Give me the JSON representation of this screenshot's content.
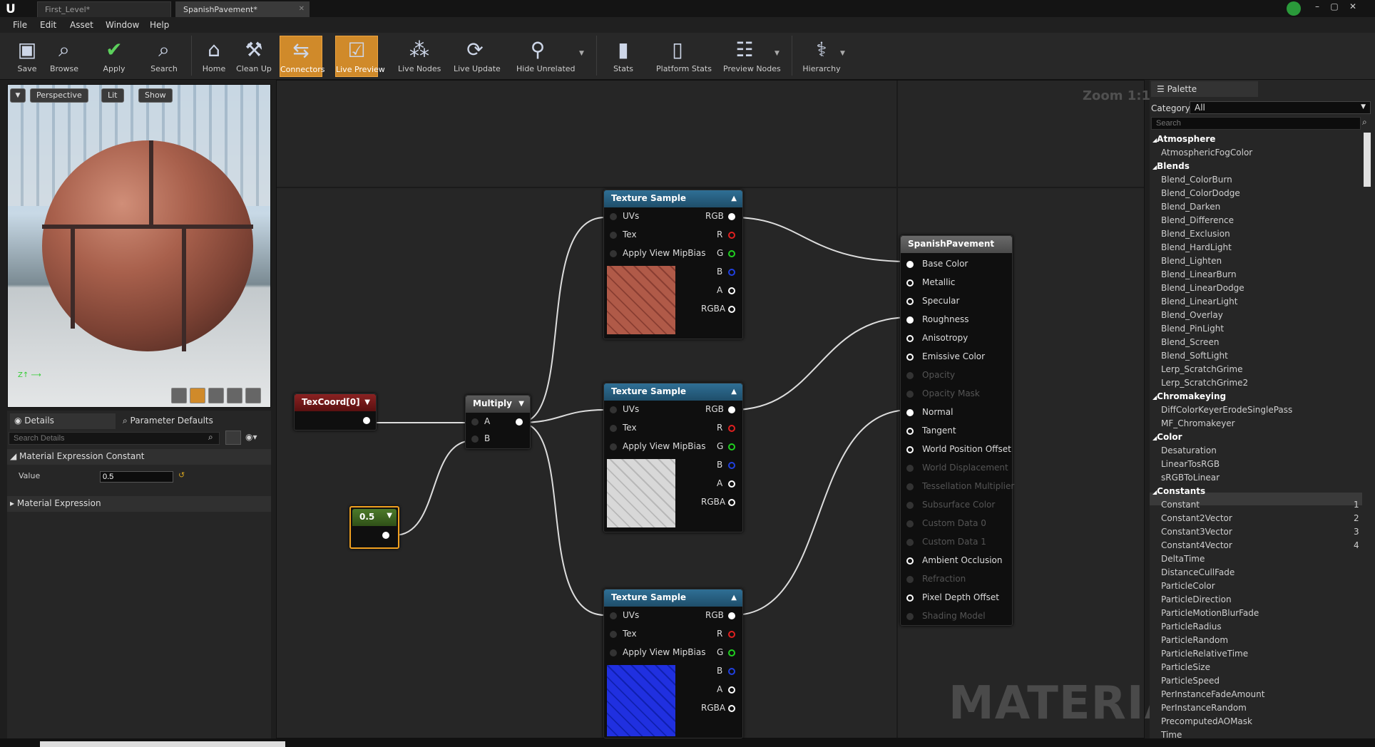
{
  "titlebar": {
    "tabs": [
      "First_Level*",
      "SpanishPavement*"
    ]
  },
  "menu": [
    "File",
    "Edit",
    "Asset",
    "Window",
    "Help"
  ],
  "toolbar": {
    "buttons": [
      "Save",
      "Browse",
      "Apply",
      "Search",
      "Home",
      "Clean Up",
      "Connectors",
      "Live Preview",
      "Live Nodes",
      "Live Update",
      "Hide Unrelated",
      "Stats",
      "Platform Stats",
      "Preview Nodes",
      "Hierarchy"
    ]
  },
  "viewport": {
    "perspective": "Perspective",
    "lit": "Lit",
    "show": "Show"
  },
  "details": {
    "tab1": "Details",
    "tab2": "Parameter Defaults",
    "search_placeholder": "Search Details",
    "section1": "Material Expression Constant",
    "value_label": "Value",
    "value": "0.5",
    "section2": "Material Expression"
  },
  "graph": {
    "zoom": "Zoom 1:1",
    "watermark": "MATERIAL",
    "texcoord": "TexCoord[0]",
    "multiply": "Multiply",
    "mul_a": "A",
    "mul_b": "B",
    "constant": "0.5",
    "tex_title": "Texture Sample",
    "tex_in": [
      "UVs",
      "Tex",
      "Apply View MipBias"
    ],
    "tex_out": [
      "RGB",
      "R",
      "G",
      "B",
      "A",
      "RGBA"
    ],
    "result_title": "SpanishPavement",
    "result_pins": [
      "Base Color",
      "Metallic",
      "Specular",
      "Roughness",
      "Anisotropy",
      "Emissive Color",
      "Opacity",
      "Opacity Mask",
      "Normal",
      "Tangent",
      "World Position Offset",
      "World Displacement",
      "Tessellation Multiplier",
      "Subsurface Color",
      "Custom Data 0",
      "Custom Data 1",
      "Ambient Occlusion",
      "Refraction",
      "Pixel Depth Offset",
      "Shading Model"
    ],
    "result_enabled": [
      true,
      true,
      true,
      true,
      true,
      true,
      false,
      false,
      true,
      true,
      true,
      false,
      false,
      false,
      false,
      false,
      true,
      false,
      true,
      false
    ]
  },
  "palette": {
    "title": "Palette",
    "category_label": "Category:",
    "category_value": "All",
    "search_placeholder": "Search",
    "groups": [
      {
        "name": "Atmosphere",
        "items": [
          "AtmosphericFogColor"
        ]
      },
      {
        "name": "Blends",
        "items": [
          "Blend_ColorBurn",
          "Blend_ColorDodge",
          "Blend_Darken",
          "Blend_Difference",
          "Blend_Exclusion",
          "Blend_HardLight",
          "Blend_Lighten",
          "Blend_LinearBurn",
          "Blend_LinearDodge",
          "Blend_LinearLight",
          "Blend_Overlay",
          "Blend_PinLight",
          "Blend_Screen",
          "Blend_SoftLight",
          "Lerp_ScratchGrime",
          "Lerp_ScratchGrime2"
        ]
      },
      {
        "name": "Chromakeying",
        "items": [
          "DiffColorKeyerErodeSinglePass",
          "MF_Chromakeyer"
        ]
      },
      {
        "name": "Color",
        "items": [
          "Desaturation",
          "LinearTosRGB",
          "sRGBToLinear"
        ]
      },
      {
        "name": "Constants",
        "items": [
          "Constant",
          "Constant2Vector",
          "Constant3Vector",
          "Constant4Vector",
          "DeltaTime",
          "DistanceCullFade",
          "ParticleColor",
          "ParticleDirection",
          "ParticleMotionBlurFade",
          "ParticleRadius",
          "ParticleRandom",
          "ParticleRelativeTime",
          "ParticleSize",
          "ParticleSpeed",
          "PerInstanceFadeAmount",
          "PerInstanceRandom",
          "PrecomputedAOMask",
          "Time"
        ]
      }
    ],
    "hotkeys": {
      "Constant": "1",
      "Constant2Vector": "2",
      "Constant3Vector": "3",
      "Constant4Vector": "4"
    }
  }
}
